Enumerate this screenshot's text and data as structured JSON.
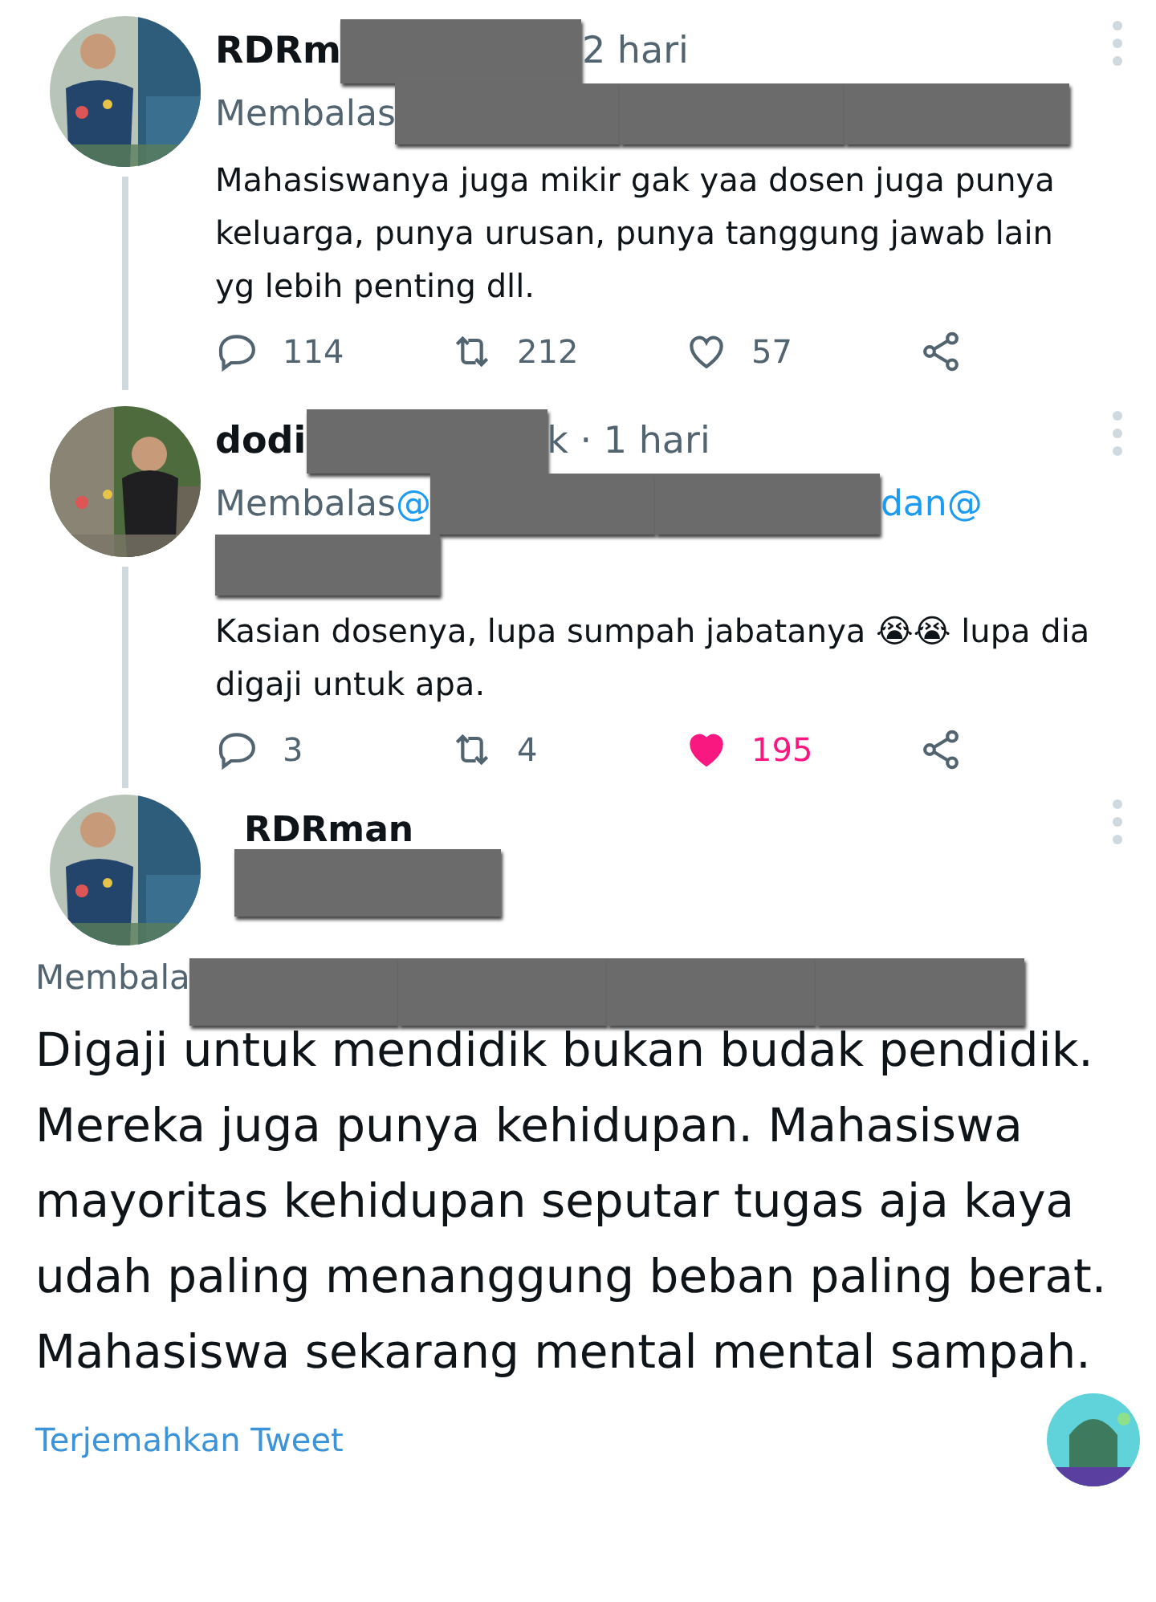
{
  "replies": [
    {
      "name": [
        {
          "kind": "text",
          "text": "RDRm"
        },
        {
          "kind": "redacted"
        },
        {
          "kind": "text",
          "text": "2 hari"
        }
      ],
      "replying": [
        {
          "kind": "muted",
          "text": "Membalas"
        },
        {
          "kind": "redacted"
        },
        {
          "kind": "redacted"
        },
        {
          "kind": "redacted"
        }
      ],
      "text": "Mahasiswanya juga mikir gak yaa dosen juga punya keluarga, punya urusan, punya tanggung jawab lain yg lebih penting dll.",
      "actions": [
        {
          "kind": "reply",
          "count": "114"
        },
        {
          "kind": "retweet",
          "count": "212"
        },
        {
          "kind": "like",
          "count": "57",
          "liked": false
        },
        {
          "kind": "share"
        }
      ]
    },
    {
      "name": [
        {
          "kind": "text",
          "text": "dodi"
        },
        {
          "kind": "redacted"
        },
        {
          "kind": "text",
          "text": "k · 1 hari"
        }
      ],
      "replying": [
        {
          "kind": "muted",
          "text": "Membalas"
        },
        {
          "kind": "mention",
          "text": "@"
        },
        {
          "kind": "redacted"
        },
        {
          "kind": "redacted"
        },
        {
          "kind": "mention",
          "text": "dan"
        },
        {
          "kind": "mention",
          "text": "@"
        },
        {
          "kind": "redacted"
        }
      ],
      "text": "Kasian dosenya, lupa sumpah jabatanya 😭😭 lupa dia digaji untuk apa.",
      "actions": [
        {
          "kind": "reply",
          "count": "3"
        },
        {
          "kind": "retweet",
          "count": "4"
        },
        {
          "kind": "like",
          "count": "195",
          "liked": true
        },
        {
          "kind": "share"
        }
      ]
    }
  ],
  "main": {
    "name": "RDRman",
    "replying": [
      {
        "kind": "muted",
        "text": "Membala"
      },
      {
        "kind": "redacted"
      },
      {
        "kind": "redacted"
      },
      {
        "kind": "redacted"
      },
      {
        "kind": "redacted"
      }
    ],
    "text": "Digaji untuk mendidik bukan budak pendidik. Mereka juga punya kehidupan. Mahasiswa mayoritas kehidupan seputar tugas aja kaya udah paling menanggung beban paling berat. Mahasiswa sekarang mental mental sampah.",
    "translate": "Terjemahkan Tweet"
  }
}
